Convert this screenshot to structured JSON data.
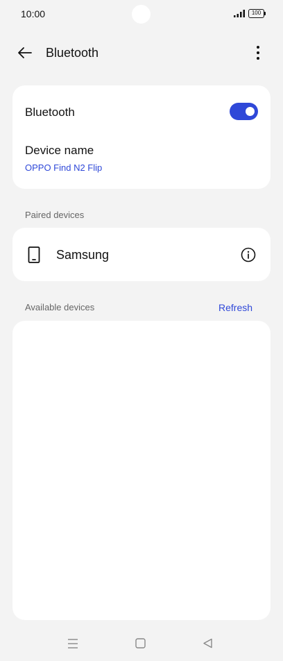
{
  "status_bar": {
    "time": "10:00",
    "battery_level": "100",
    "icons": [
      "signal-icon",
      "battery-icon"
    ]
  },
  "app_bar": {
    "title": "Bluetooth",
    "icons": [
      "back-arrow-icon",
      "more-vert-icon"
    ]
  },
  "settings": {
    "bluetooth_label": "Bluetooth",
    "bluetooth_enabled": true,
    "device_name_label": "Device name",
    "device_name_value": "OPPO Find N2 Flip"
  },
  "paired": {
    "section_label": "Paired devices",
    "devices": [
      {
        "name": "Samsung",
        "icon": "smartphone-icon",
        "action_icon": "info-icon"
      }
    ]
  },
  "available": {
    "section_label": "Available devices",
    "refresh_label": "Refresh",
    "devices": []
  },
  "nav_bar": {
    "icons": [
      "recents-menu-icon",
      "home-square-icon",
      "back-triangle-icon"
    ]
  },
  "colors": {
    "accent": "#2f48d8",
    "background": "#f3f3f3",
    "card": "#ffffff",
    "text_primary": "#111111",
    "text_secondary": "#666666"
  }
}
